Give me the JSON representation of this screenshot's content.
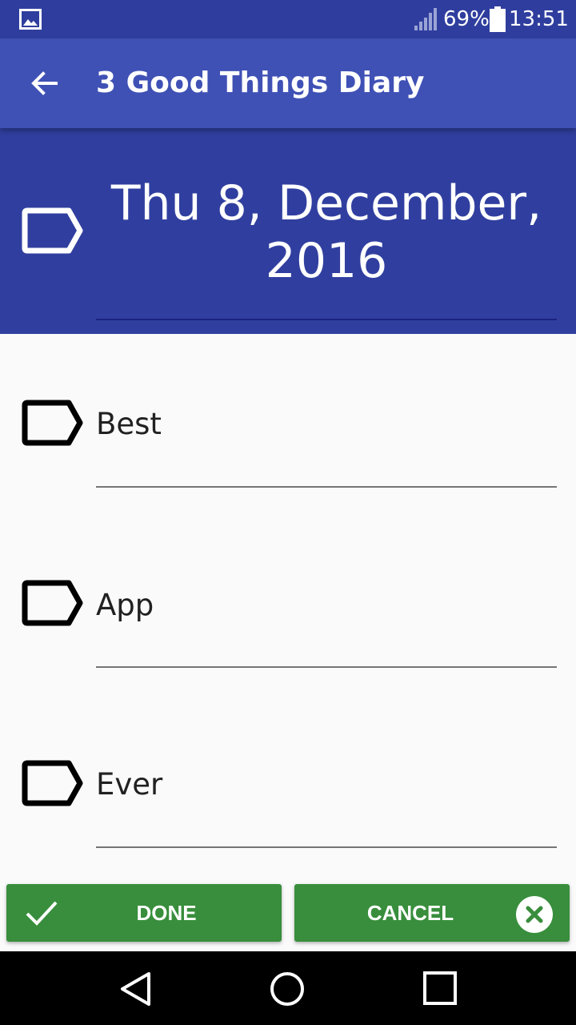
{
  "status_bar": {
    "battery_percent": "69%",
    "time": "13:51",
    "icons": [
      "image-icon",
      "signal-icon",
      "battery-icon"
    ]
  },
  "app_bar": {
    "title": "3 Good Things Diary",
    "back_icon": "arrow-back-icon"
  },
  "header": {
    "date_line1": "Thu 8, December,",
    "date_line2": "2016",
    "icon": "tag-icon"
  },
  "entries": [
    {
      "text": "Best",
      "icon": "tag-icon"
    },
    {
      "text": "App",
      "icon": "tag-icon"
    },
    {
      "text": "Ever",
      "icon": "tag-icon"
    }
  ],
  "buttons": {
    "done_label": "DONE",
    "cancel_label": "CANCEL",
    "done_icon": "check-icon",
    "cancel_icon": "close-circle-icon"
  },
  "nav_bar": {
    "icons": [
      "back-triangle-icon",
      "home-circle-icon",
      "recents-square-icon"
    ]
  },
  "colors": {
    "status_bar": "#2f3e9e",
    "app_bar": "#3f51b5",
    "header": "#303f9f",
    "button": "#388e3c",
    "background": "#fafafa"
  }
}
